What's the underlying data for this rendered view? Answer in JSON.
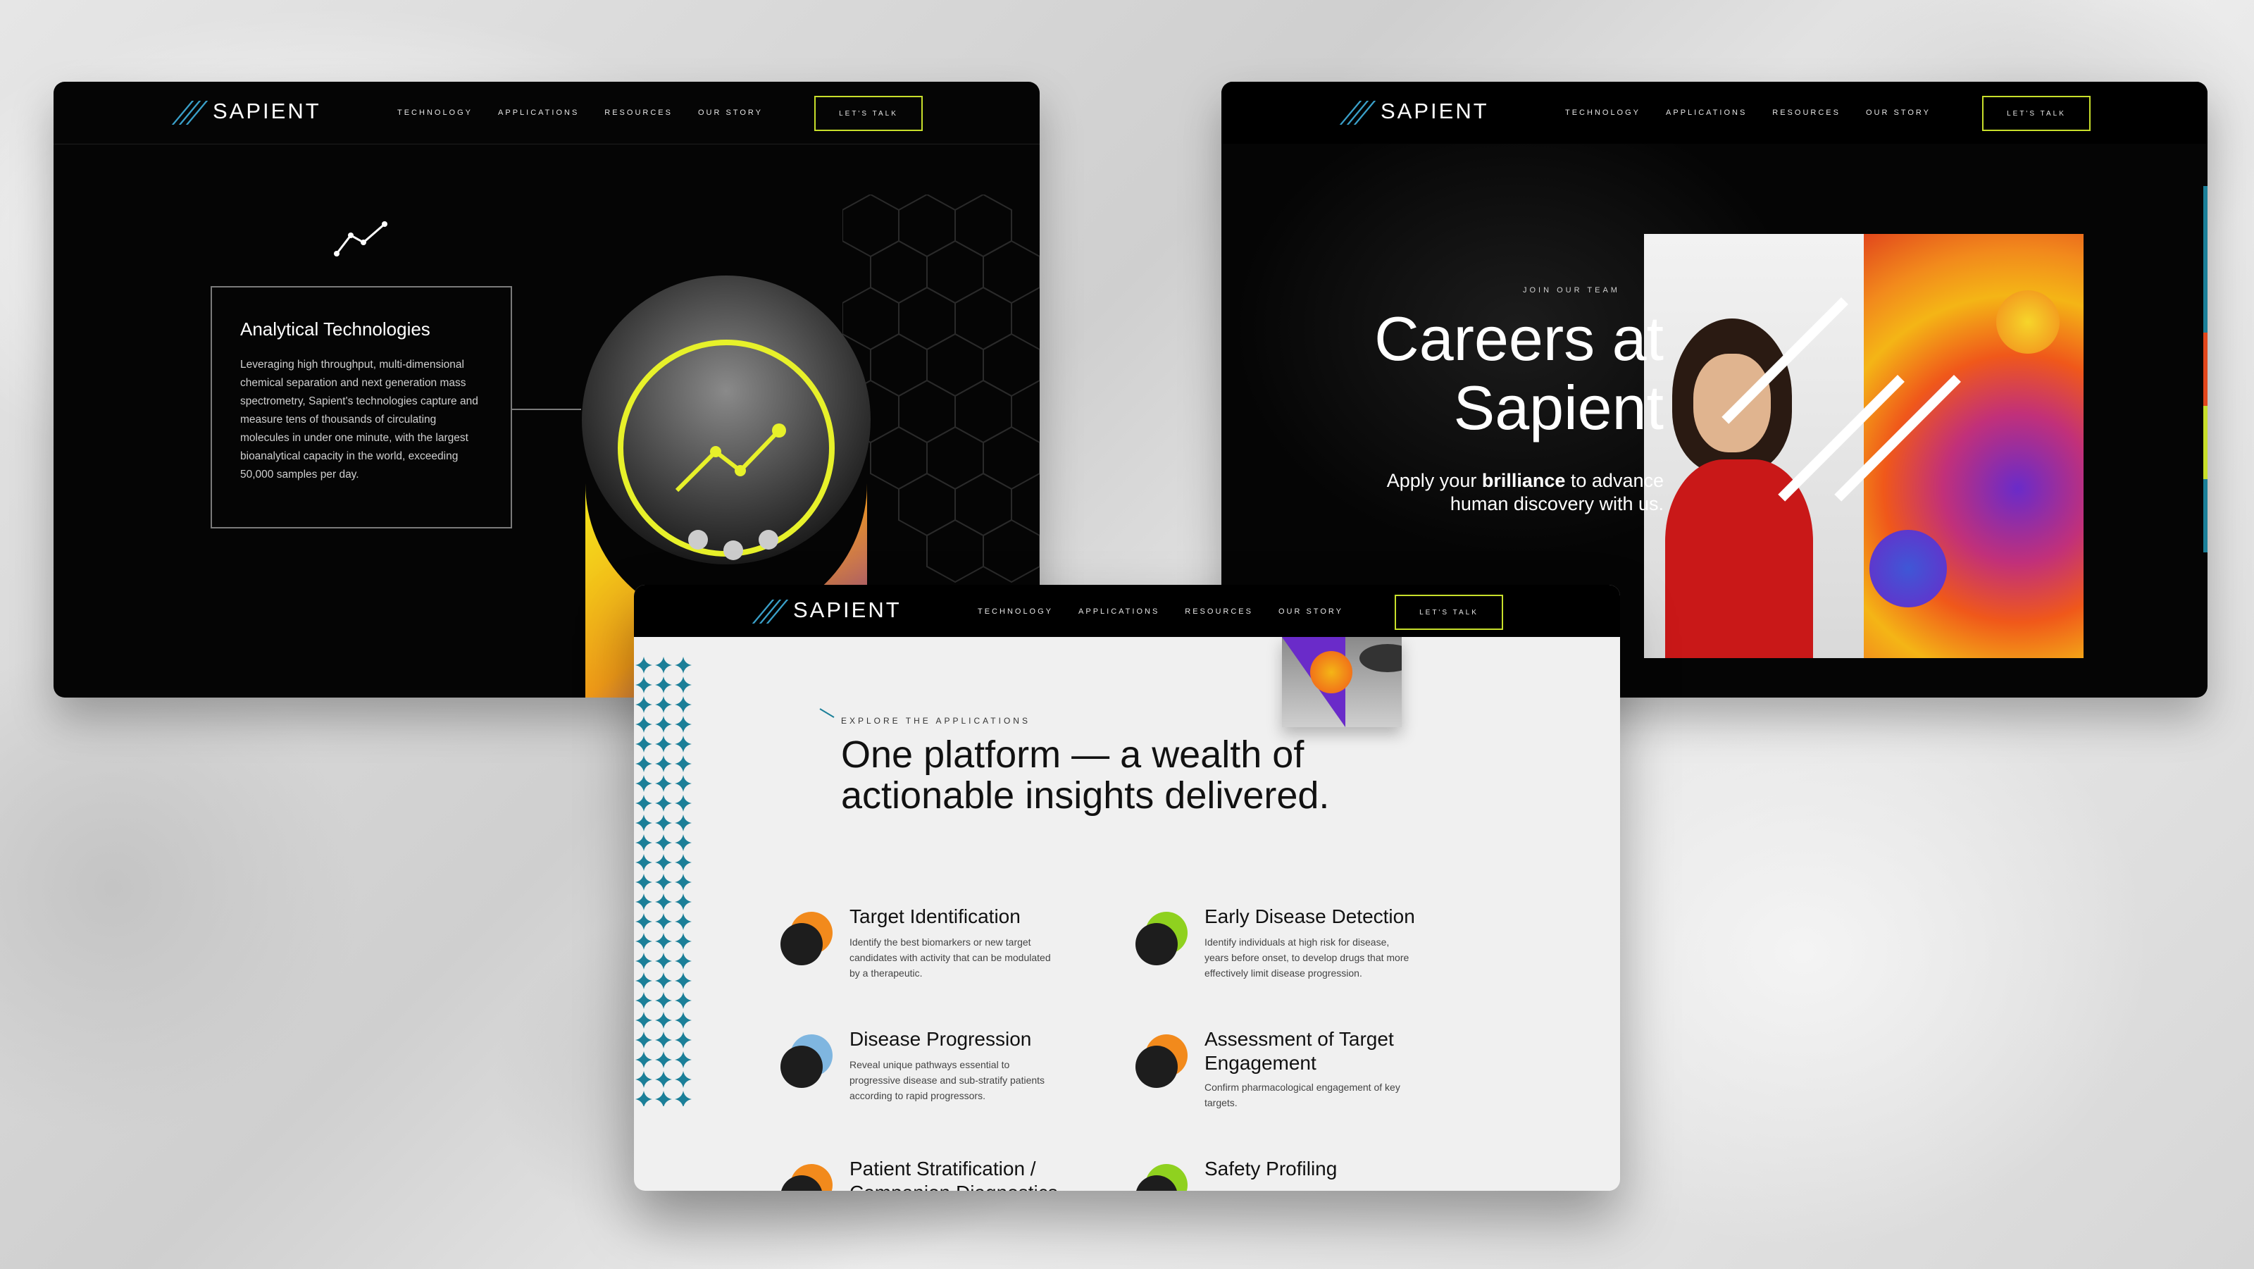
{
  "nav": {
    "logo": "SAPIENT",
    "links": [
      "TECHNOLOGY",
      "APPLICATIONS",
      "RESOURCES",
      "OUR STORY"
    ],
    "cta": "LET'S TALK"
  },
  "card1": {
    "title": "Analytical Technologies",
    "body": "Leveraging high throughput, multi-dimensional chemical separation and next generation mass spectrometry, Sapient's technologies capture and measure tens of thousands of circulating molecules in under one minute, with the largest bioanalytical capacity in the world, exceeding 50,000 samples per day.",
    "icon": "line-chart-icon"
  },
  "card2": {
    "eyebrow": "JOIN OUR TEAM",
    "title_line1": "Careers at",
    "title_line2": "Sapient",
    "sub_pre": "Apply your ",
    "sub_bold": "brilliance",
    "sub_post": " to advance",
    "sub_line2": "human discovery with us."
  },
  "card3": {
    "eyebrow": "EXPLORE THE APPLICATIONS",
    "headline_light": "One platform — a ",
    "headline_bold1": "wealth of",
    "headline_bold2": "actionable insights delivered.",
    "apps": [
      {
        "title": "Target Identification",
        "desc": "Identify the best biomarkers or new target candidates with activity that can be modulated by a therapeutic.",
        "accent": "#f28a1c"
      },
      {
        "title": "Early Disease Detection",
        "desc": "Identify individuals at high risk for disease, years before onset, to develop drugs that more effectively limit disease progression.",
        "accent": "#8fd11f"
      },
      {
        "title": "Disease Progression",
        "desc": "Reveal unique pathways essential to progressive disease and sub-stratify patients according to rapid progressors.",
        "accent": "#7fb6e0"
      },
      {
        "title": "Assessment of Target Engagement",
        "desc": "Confirm pharmacological engagement of key targets.",
        "accent": "#f28a1c"
      },
      {
        "title": "Patient Stratification / Companion Diagnostics",
        "desc": "",
        "accent": "#f28a1c"
      },
      {
        "title": "Safety Profiling",
        "desc": "",
        "accent": "#8fd11f"
      }
    ]
  },
  "colors": {
    "accent_green": "#c8df2b",
    "brand_blue": "#3aa0c9",
    "teal": "#1b7f98"
  }
}
